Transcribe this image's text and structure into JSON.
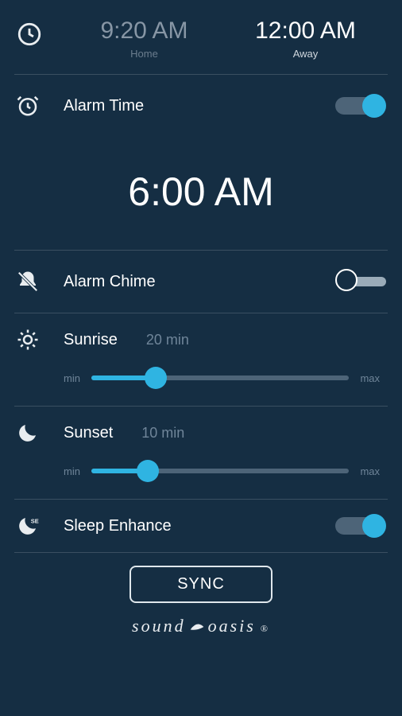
{
  "header": {
    "home": {
      "time": "9:20 AM",
      "label": "Home"
    },
    "away": {
      "time": "12:00 AM",
      "label": "Away"
    }
  },
  "alarmTime": {
    "label": "Alarm Time",
    "value": "6:00 AM",
    "enabled": true
  },
  "alarmChime": {
    "label": "Alarm Chime",
    "enabled": false
  },
  "sunrise": {
    "label": "Sunrise",
    "value": "20 min",
    "minLabel": "min",
    "maxLabel": "max",
    "percent": 25
  },
  "sunset": {
    "label": "Sunset",
    "value": "10 min",
    "minLabel": "min",
    "maxLabel": "max",
    "percent": 22
  },
  "sleepEnhance": {
    "label": "Sleep Enhance",
    "enabled": true
  },
  "sync": {
    "label": "SYNC"
  },
  "brand": {
    "part1": "sound",
    "part2": "oasis"
  }
}
